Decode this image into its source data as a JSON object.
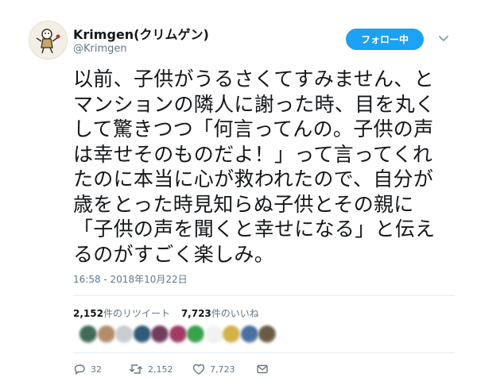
{
  "user": {
    "name": "Krimgen(クリムゲン)",
    "handle": "@Krimgen"
  },
  "follow_label": "フォロー中",
  "tweet": {
    "lines": [
      "以前、子供がうるさくてすみません、と",
      "マンションの隣人に謝った時、目を丸く",
      "して驚きつつ「何言ってんの。子供の声",
      "は幸せそのものだよ！」って言ってくれ",
      "たのに本当に心が救われたので、自分が",
      "歳をとった時見知らぬ子供とその親に",
      "「子供の声を聞くと幸せになる」と伝え",
      "るのがすごく楽しみ。"
    ]
  },
  "timestamp": "16:58 - 2018年10月22日",
  "stats": {
    "retweets_count": "2,152",
    "retweets_label": "件のリツイート",
    "likes_count": "7,723",
    "likes_label": "件のいいね"
  },
  "likers_colors": [
    "#3f6b58",
    "#b58c6a",
    "#c9cdd0",
    "#2f5a78",
    "#6f3e5c",
    "#a13b66",
    "#36a24a",
    "#f2f2f2",
    "#d3b14a",
    "#4a6fa1",
    "#6b5a46"
  ],
  "actions": {
    "reply_count": "32",
    "retweet_count": "2,152",
    "like_count": "7,723"
  },
  "icons": {
    "reply": "reply-icon",
    "retweet": "retweet-icon",
    "like": "heart-icon",
    "dm": "envelope-icon",
    "caret": "chevron-down-icon"
  },
  "colors": {
    "accent": "#1da1f2",
    "text": "#14171a",
    "muted": "#657786"
  }
}
